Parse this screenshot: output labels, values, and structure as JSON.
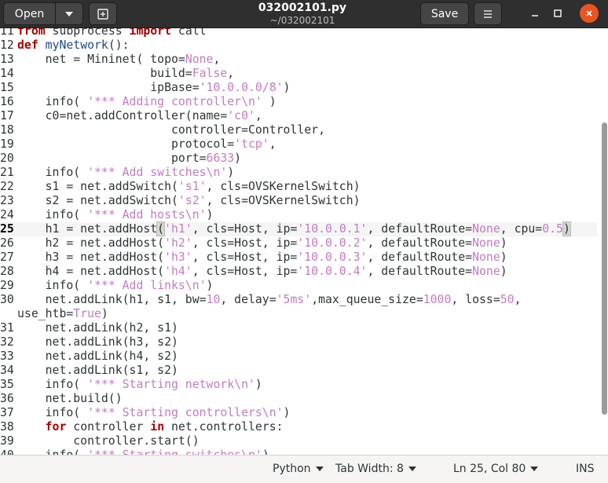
{
  "headerbar": {
    "open_label": "Open",
    "title": "032002101.py",
    "subtitle": "~/032002101",
    "save_label": "Save"
  },
  "colors": {
    "keyword": "#a40000",
    "function": "#204a87",
    "string": "#c17dc0",
    "close_button": "#e95420"
  },
  "icons": [
    "chevron-down-icon",
    "new-tab-icon",
    "hamburger-menu-icon",
    "minimize-icon",
    "maximize-icon",
    "close-icon"
  ],
  "editor": {
    "current_line": 25,
    "lines": [
      {
        "n": "11",
        "text": "from subprocess import call"
      },
      {
        "n": "12",
        "text": "def myNetwork():"
      },
      {
        "n": "13",
        "text": "    net = Mininet( topo=None,"
      },
      {
        "n": "14",
        "text": "                   build=False,"
      },
      {
        "n": "15",
        "text": "                   ipBase='10.0.0.0/8')"
      },
      {
        "n": "16",
        "text": "    info( '*** Adding controller\\n' )"
      },
      {
        "n": "17",
        "text": "    c0=net.addController(name='c0',"
      },
      {
        "n": "18",
        "text": "                      controller=Controller,"
      },
      {
        "n": "19",
        "text": "                      protocol='tcp',"
      },
      {
        "n": "20",
        "text": "                      port=6633)"
      },
      {
        "n": "21",
        "text": "    info( '*** Add switches\\n')"
      },
      {
        "n": "22",
        "text": "    s1 = net.addSwitch('s1', cls=OVSKernelSwitch)"
      },
      {
        "n": "23",
        "text": "    s2 = net.addSwitch('s2', cls=OVSKernelSwitch)"
      },
      {
        "n": "24",
        "text": "    info( '*** Add hosts\\n')"
      },
      {
        "n": "25",
        "text": "    h1 = net.addHost('h1', cls=Host, ip='10.0.0.1', defaultRoute=None, cpu=0.5)"
      },
      {
        "n": "26",
        "text": "    h2 = net.addHost('h2', cls=Host, ip='10.0.0.2', defaultRoute=None)"
      },
      {
        "n": "27",
        "text": "    h3 = net.addHost('h3', cls=Host, ip='10.0.0.3', defaultRoute=None)"
      },
      {
        "n": "28",
        "text": "    h4 = net.addHost('h4', cls=Host, ip='10.0.0.4', defaultRoute=None)"
      },
      {
        "n": "29",
        "text": "    info( '*** Add links\\n')"
      },
      {
        "n": "30",
        "text": "    net.addLink(h1, s1, bw=10, delay='5ms',max_queue_size=1000, loss=50,",
        "cont": "use_htb=True)"
      },
      {
        "n": "31",
        "text": "    net.addLink(h2, s1)"
      },
      {
        "n": "32",
        "text": "    net.addLink(h3, s2)"
      },
      {
        "n": "33",
        "text": "    net.addLink(h4, s2)"
      },
      {
        "n": "34",
        "text": "    net.addLink(s1, s2)"
      },
      {
        "n": "35",
        "text": "    info( '*** Starting network\\n')"
      },
      {
        "n": "36",
        "text": "    net.build()"
      },
      {
        "n": "37",
        "text": "    info( '*** Starting controllers\\n')"
      },
      {
        "n": "38",
        "text": "    for controller in net.controllers:"
      },
      {
        "n": "39",
        "text": "        controller.start()"
      },
      {
        "n": "40",
        "text": "    info( '*** Starting switches\\n')"
      }
    ]
  },
  "statusbar": {
    "language": "Python",
    "tab_width": "Tab Width: 8",
    "position": "Ln 25, Col 80",
    "mode": "INS"
  }
}
